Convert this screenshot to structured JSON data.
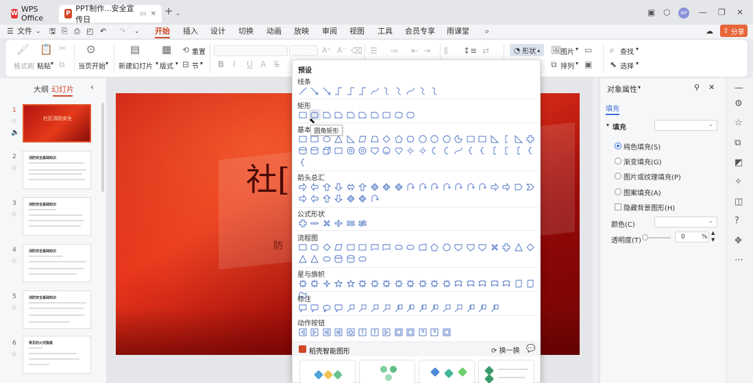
{
  "titlebar": {
    "app_tab": "WPS Office",
    "doc_tab": "PPT制作...安全宣传日",
    "new_tab": "+",
    "avatar": "WP"
  },
  "menu": {
    "file": "文件",
    "tabs": [
      "开始",
      "插入",
      "设计",
      "切换",
      "动画",
      "放映",
      "审阅",
      "视图",
      "工具",
      "会员专享",
      "雨课堂"
    ],
    "active_tab": "开始",
    "share": "分享"
  },
  "ribbon": {
    "format_painter": "格式刷",
    "paste": "粘贴",
    "play_from_current": "当页开始",
    "new_slide": "新建幻灯片",
    "layout": "版式",
    "section": "节",
    "reset": "重置",
    "shapes": "形状",
    "picture": "图片",
    "arrange": "排列",
    "find": "查找",
    "select": "选择"
  },
  "left_panel": {
    "tab_outline": "大纲",
    "tab_slides": "幻灯片",
    "slides": [
      {
        "num": "1",
        "title": "社区消防安全"
      },
      {
        "num": "2",
        "title": "消防安全基础知识"
      },
      {
        "num": "3",
        "title": "消防安全基础知识"
      },
      {
        "num": "4",
        "title": "消防安全基础知识"
      },
      {
        "num": "5",
        "title": "消防安全基础知识"
      },
      {
        "num": "6",
        "title": "常见的火灾隐患"
      }
    ]
  },
  "slide": {
    "title_visible": "社[",
    "sub_visible": "防"
  },
  "shapes_dropdown": {
    "header": "预设",
    "sections": {
      "lines": "线条",
      "rect": "矩形",
      "basic": "基本",
      "arrows": "箭头总汇",
      "equation": "公式形状",
      "flowchart": "流程图",
      "stars": "星与旗帜",
      "callouts": "标注",
      "actions": "动作按钮"
    },
    "tooltip": "圆角矩形",
    "smart_title": "稻壳智能图形",
    "smart_refresh": "换一换"
  },
  "right_panel": {
    "title": "对象属性",
    "tab_fill": "填充",
    "fill_section": "填充",
    "options": [
      "纯色填充(S)",
      "渐变填充(G)",
      "图片或纹理填充(P)",
      "图案填充(A)"
    ],
    "hide_bg": "隐藏背景图形(H)",
    "color_label": "颜色(C)",
    "transparency_label": "透明度(T)",
    "transparency_value": "0",
    "transparency_unit": "%"
  },
  "colors": {
    "accent": "#d24726",
    "link_blue": "#3a6fd8",
    "shape_stroke": "#4a72c4"
  }
}
